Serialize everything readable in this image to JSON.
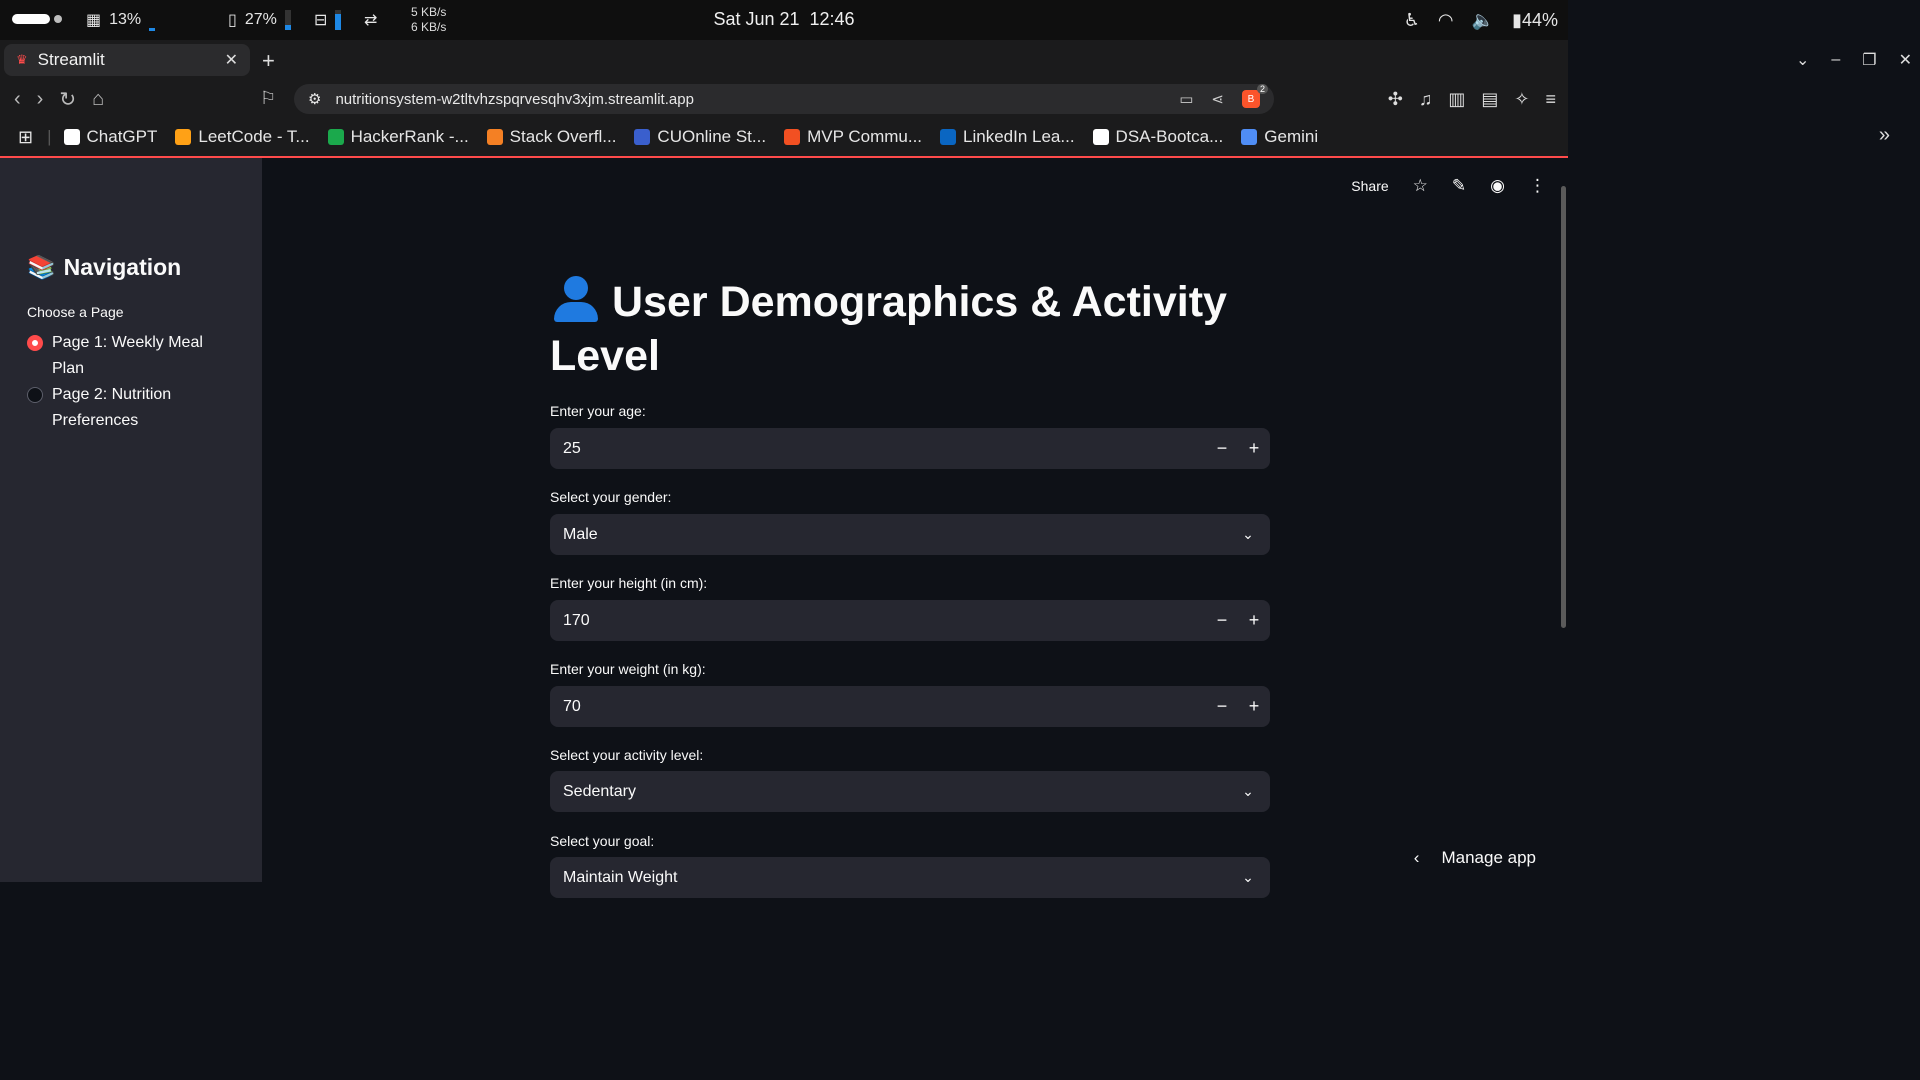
{
  "system": {
    "cpu": "13%",
    "mem": "27%",
    "net_down": "5 KB/s",
    "net_up": "6 KB/s",
    "date": "Sat Jun 21",
    "time": "12:46",
    "battery": "44%",
    "cpu_graph_level": 0.13,
    "mem_bar_level": 0.27,
    "disk_bar_level": 0.8
  },
  "browser": {
    "tab_title": "Streamlit",
    "url": "nutritionsystem-w2tltvhzspqrvesqhv3xjm.streamlit.app",
    "shield_count": "2",
    "bookmarks": [
      {
        "label": "ChatGPT",
        "icon": "chatgpt-icon",
        "color": "#ffffff"
      },
      {
        "label": "LeetCode - T...",
        "icon": "leetcode-icon",
        "color": "#ffa116"
      },
      {
        "label": "HackerRank -...",
        "icon": "hackerrank-icon",
        "color": "#1ba94c"
      },
      {
        "label": "Stack Overfl...",
        "icon": "stackoverflow-icon",
        "color": "#f48024"
      },
      {
        "label": "CUOnline St...",
        "icon": "cuonline-icon",
        "color": "#3a5fcd"
      },
      {
        "label": "MVP Commu...",
        "icon": "microsoft-icon",
        "color": "#f25022"
      },
      {
        "label": "LinkedIn Lea...",
        "icon": "linkedin-icon",
        "color": "#0a66c2"
      },
      {
        "label": "DSA-Bootca...",
        "icon": "github-icon",
        "color": "#ffffff"
      },
      {
        "label": "Gemini",
        "icon": "gemini-icon",
        "color": "#4f8df5"
      }
    ]
  },
  "sidebar": {
    "title": "Navigation",
    "radio_label": "Choose a Page",
    "options": [
      {
        "label": "Page 1: Weekly Meal Plan",
        "selected": true
      },
      {
        "label": "Page 2: Nutrition Preferences",
        "selected": false
      }
    ]
  },
  "header": {
    "share_label": "Share"
  },
  "main": {
    "title": "User Demographics & Activity Level",
    "fields": [
      {
        "label": "Enter your age:",
        "value": "25",
        "type": "number"
      },
      {
        "label": "Select your gender:",
        "value": "Male",
        "type": "select"
      },
      {
        "label": "Enter your height (in cm):",
        "value": "170",
        "type": "number"
      },
      {
        "label": "Enter your weight (in kg):",
        "value": "70",
        "type": "number"
      },
      {
        "label": "Select your activity level:",
        "value": "Sedentary",
        "type": "select"
      },
      {
        "label": "Select your goal:",
        "value": "Maintain Weight",
        "type": "select"
      }
    ]
  },
  "footer": {
    "manage_label": "Manage app"
  },
  "colors": {
    "accent": "#ff4b4b",
    "sidebar_bg": "#262730",
    "main_bg": "#0e1117",
    "input_bg": "#262730"
  }
}
